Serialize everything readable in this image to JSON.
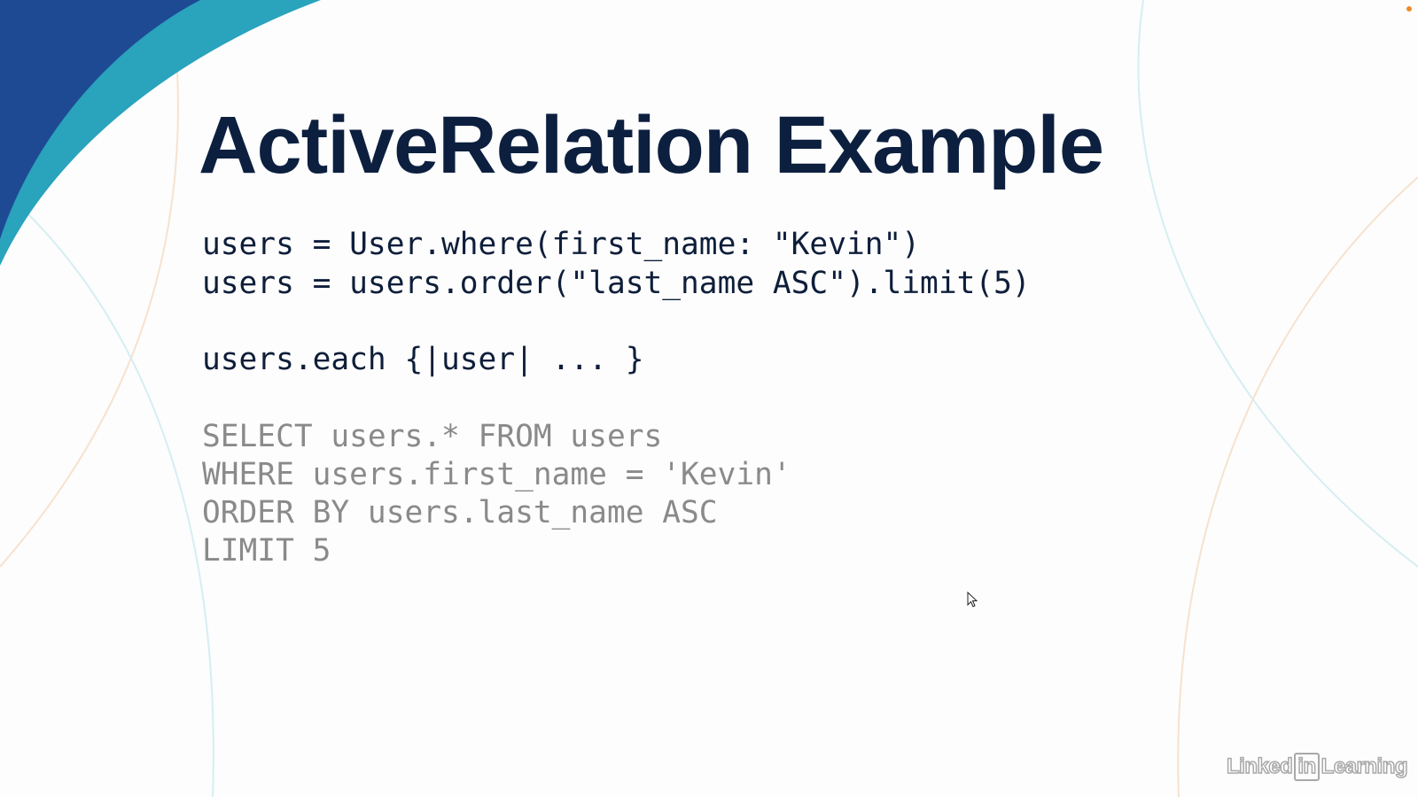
{
  "slide": {
    "title": "ActiveRelation Example",
    "ruby_lines": [
      "users = User.where(first_name: \"Kevin\")",
      "users = users.order(\"last_name ASC\").limit(5)",
      "users.each {|user| ... }"
    ],
    "sql_lines": [
      "SELECT users.* FROM users",
      "WHERE users.first_name = 'Kevin'",
      "ORDER BY users.last_name ASC",
      "LIMIT 5"
    ]
  },
  "watermark": {
    "part1": "Linked",
    "part2": "in",
    "part3": "Learning"
  },
  "colors": {
    "navy": "#1e4a94",
    "teal": "#2aa3bd",
    "title": "#0c1f3f"
  }
}
